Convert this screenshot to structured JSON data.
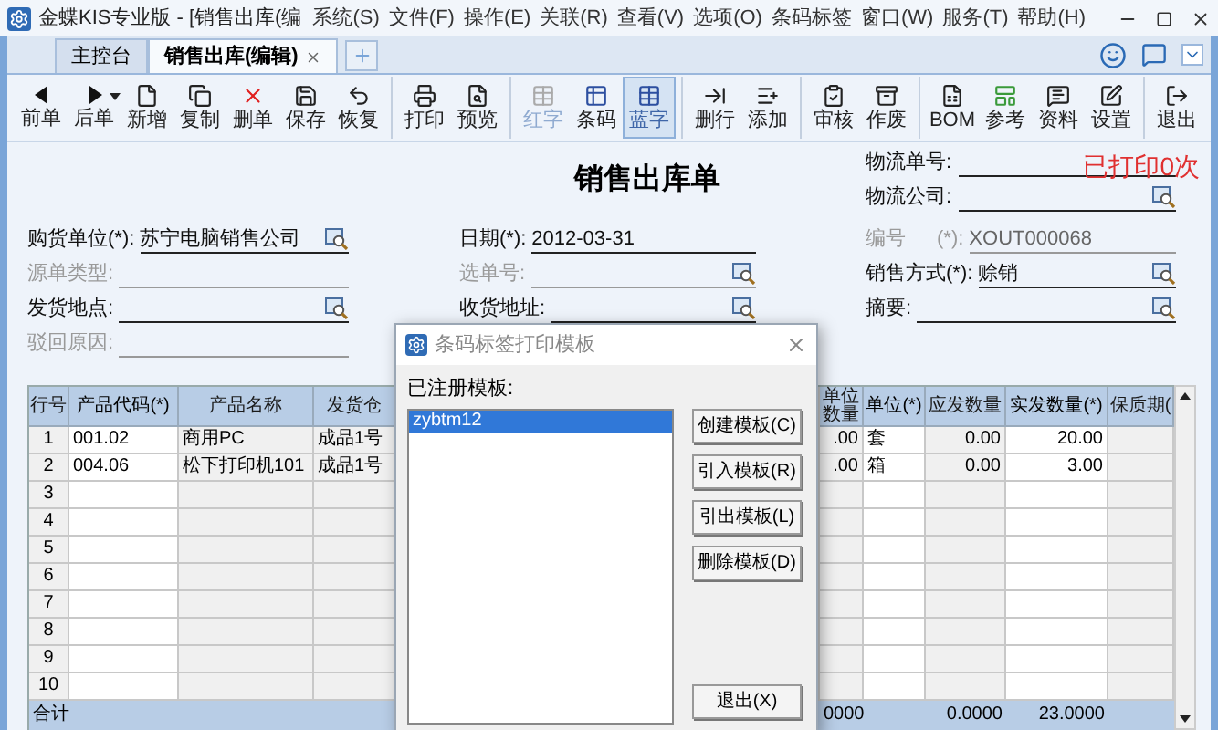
{
  "window": {
    "title": "金蝶KIS专业版 - [销售出库(编"
  },
  "menu": [
    "系统(S)",
    "文件(F)",
    "操作(E)",
    "关联(R)",
    "查看(V)",
    "选项(O)",
    "条码标签",
    "窗口(W)",
    "服务(T)",
    "帮助(H)"
  ],
  "tabs": [
    {
      "label": "主控台",
      "selected": false,
      "closable": false
    },
    {
      "label": "销售出库(编辑)",
      "selected": true,
      "closable": true
    }
  ],
  "toolbar": [
    [
      {
        "label": "前单",
        "disabled": false,
        "selected": false,
        "dropdown": false
      },
      {
        "label": "后单",
        "disabled": false,
        "selected": false,
        "dropdown": true
      },
      {
        "label": "新增",
        "disabled": false,
        "selected": false,
        "dropdown": false
      },
      {
        "label": "复制",
        "disabled": false,
        "selected": false,
        "dropdown": false
      },
      {
        "label": "删单",
        "disabled": false,
        "selected": false,
        "dropdown": false
      },
      {
        "label": "保存",
        "disabled": false,
        "selected": false,
        "dropdown": false
      },
      {
        "label": "恢复",
        "disabled": false,
        "selected": false,
        "dropdown": false
      }
    ],
    [
      {
        "label": "打印",
        "disabled": false,
        "selected": false,
        "dropdown": false
      },
      {
        "label": "预览",
        "disabled": false,
        "selected": false,
        "dropdown": false
      }
    ],
    [
      {
        "label": "红字",
        "disabled": true,
        "selected": false,
        "dropdown": false
      },
      {
        "label": "条码",
        "disabled": false,
        "selected": false,
        "dropdown": false
      },
      {
        "label": "蓝字",
        "disabled": false,
        "selected": true,
        "dropdown": false
      }
    ],
    [
      {
        "label": "删行",
        "disabled": false,
        "selected": false,
        "dropdown": false
      },
      {
        "label": "添加",
        "disabled": false,
        "selected": false,
        "dropdown": false
      }
    ],
    [
      {
        "label": "审核",
        "disabled": false,
        "selected": false,
        "dropdown": false
      },
      {
        "label": "作废",
        "disabled": false,
        "selected": false,
        "dropdown": false
      }
    ],
    [
      {
        "label": "BOM",
        "disabled": false,
        "selected": false,
        "dropdown": false
      },
      {
        "label": "参考",
        "disabled": false,
        "selected": false,
        "dropdown": false
      },
      {
        "label": "资料",
        "disabled": false,
        "selected": false,
        "dropdown": false
      },
      {
        "label": "设置",
        "disabled": false,
        "selected": false,
        "dropdown": false
      }
    ],
    [
      {
        "label": "退出",
        "disabled": false,
        "selected": false,
        "dropdown": false
      }
    ]
  ],
  "form": {
    "title": "销售出库单",
    "print_status": "已打印0次",
    "logistics": [
      {
        "label": "物流单号:",
        "disabled": false,
        "lookup": false
      },
      {
        "label": "物流公司:",
        "disabled": false,
        "lookup": true
      }
    ],
    "columns": [
      [
        {
          "label": "购货单位(*):",
          "value": "苏宁电脑销售公司",
          "disabled": false,
          "lookup": true
        },
        {
          "label": "源单类型:",
          "disabled": true,
          "lookup": false
        },
        {
          "label": "发货地点:",
          "disabled": false,
          "lookup": true
        },
        {
          "label": "驳回原因:",
          "disabled": true,
          "lookup": false
        }
      ],
      [
        {
          "label": "日期(*):",
          "value": "2012-03-31",
          "disabled": false,
          "lookup": false
        },
        {
          "label": "选单号:",
          "disabled": true,
          "lookup": true
        },
        {
          "label": "收货地址:",
          "disabled": false,
          "lookup": true
        }
      ],
      [
        {
          "label": "编号",
          "suffix": "(*):",
          "value": "XOUT000068",
          "disabled": true,
          "lookup": false
        },
        {
          "label": "销售方式(*):",
          "value": "赊销",
          "disabled": false,
          "lookup": true
        },
        {
          "label": "摘要:",
          "disabled": false,
          "lookup": true
        }
      ]
    ]
  },
  "table": {
    "columns": [
      {
        "label": "行号",
        "readonly": true
      },
      {
        "label": "产品代码(*)",
        "readonly": false
      },
      {
        "label": "产品名称",
        "readonly": true
      },
      {
        "label": "发货仓",
        "readonly": true
      },
      {
        "label": "单位数量",
        "readonly": true
      },
      {
        "label": "单位(*)",
        "readonly": false
      },
      {
        "label": "应发数量",
        "readonly": true
      },
      {
        "label": "实发数量(*)",
        "readonly": false
      },
      {
        "label": "保质期(",
        "readonly": true
      }
    ],
    "rows": [
      [
        "1",
        "001.02",
        "商用PC",
        "成品1号",
        ".00",
        "套",
        "0.00",
        "20.00"
      ],
      [
        "2",
        "004.06",
        "松下打印机101",
        "成品1号",
        ".00",
        "箱",
        "0.00",
        "3.00"
      ],
      [
        "3"
      ],
      [
        "4"
      ],
      [
        "5"
      ],
      [
        "6"
      ],
      [
        "7"
      ],
      [
        "8"
      ],
      [
        "9"
      ],
      [
        "10"
      ]
    ],
    "totals": {
      "label": "合计",
      "unit_quantity": "0000",
      "due_quantity": "0.0000",
      "shipped_quantity": "23.0000"
    }
  },
  "dialog": {
    "title": "条码标签打印模板",
    "list_label": "已注册模板:",
    "templates": [
      {
        "name": "zybtm12",
        "selected": true
      }
    ],
    "buttons": [
      "创建模板(C)",
      "引入模板(R)",
      "引出模板(L)",
      "删除模板(D)"
    ],
    "exit_button": "退出(X)"
  }
}
